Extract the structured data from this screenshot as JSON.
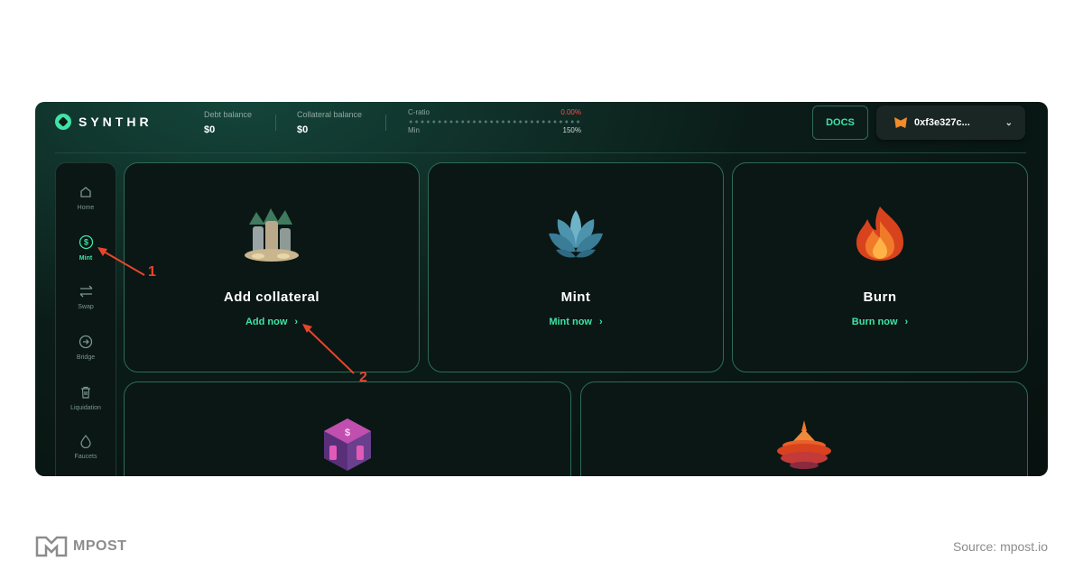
{
  "header": {
    "brand": "SYNTHR",
    "debt_label": "Debt balance",
    "debt_value": "$0",
    "collateral_label": "Collateral balance",
    "collateral_value": "$0",
    "cratio_label": "C-ratio",
    "cratio_value": "0.00%",
    "min_label": "Min",
    "min_value": "150%",
    "docs_label": "DOCS",
    "wallet_address": "0xf3e327c..."
  },
  "sidebar": {
    "items": [
      {
        "label": "Home",
        "icon": "home-icon",
        "active": false
      },
      {
        "label": "Mint",
        "icon": "dollar-circle-icon",
        "active": true
      },
      {
        "label": "Swap",
        "icon": "swap-arrows-icon",
        "active": false
      },
      {
        "label": "Bridge",
        "icon": "arrow-circle-icon",
        "active": false
      },
      {
        "label": "Liquidation",
        "icon": "trash-icon",
        "active": false
      },
      {
        "label": "Faucets",
        "icon": "droplet-icon",
        "active": false
      }
    ]
  },
  "cards": [
    {
      "title": "Add collateral",
      "link": "Add now",
      "icon": "coins-stack-icon"
    },
    {
      "title": "Mint",
      "link": "Mint now",
      "icon": "lotus-icon"
    },
    {
      "title": "Burn",
      "link": "Burn now",
      "icon": "flame-icon"
    },
    {
      "title": "",
      "link": "",
      "icon": "dollar-cube-icon"
    },
    {
      "title": "",
      "link": "",
      "icon": "spinning-top-icon"
    }
  ],
  "annotations": [
    "1",
    "2"
  ],
  "footer": {
    "brand": "MPOST",
    "source": "Source: mpost.io"
  },
  "colors": {
    "accent": "#3fe3a6",
    "background": "#0b1c18",
    "annotation": "#e8452c",
    "negative": "#ff4d4d"
  }
}
